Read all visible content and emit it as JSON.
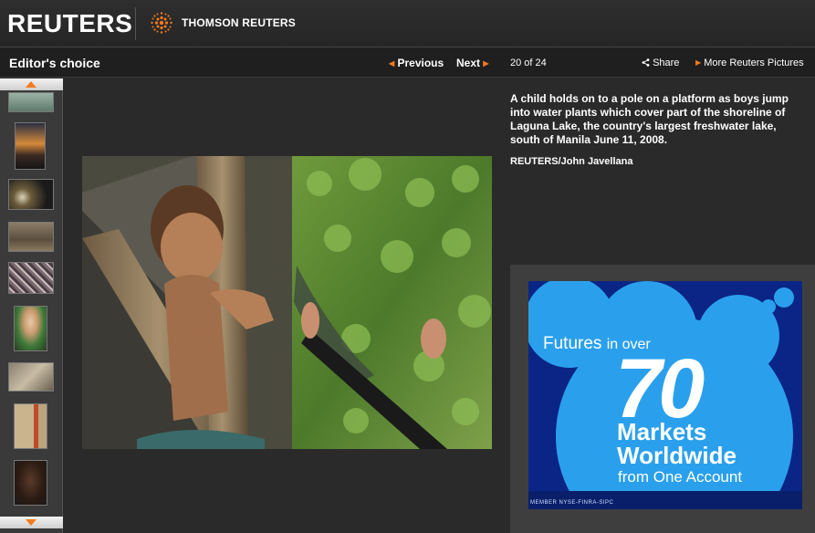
{
  "header": {
    "logo": "REUTERS",
    "partner": "THOMSON REUTERS"
  },
  "toolbar": {
    "section_title": "Editor's choice",
    "previous": "Previous",
    "next": "Next",
    "counter": "20 of 24",
    "share": "Share",
    "more": "More Reuters Pictures"
  },
  "caption": {
    "text": "A child holds on to a pole on a platform as boys jump into water plants which cover part of the shoreline of Laguna Lake, the country's largest freshwater lake, south of Manila June 11, 2008.",
    "credit": "REUTERS/John Javellana"
  },
  "ad": {
    "line1_a": "Futures",
    "line1_b": "in over",
    "big": "70",
    "line2": "Markets",
    "line3": "Worldwide",
    "line4": "from One Account",
    "member": "MEMBER NYSE-FINRA-SIPC"
  },
  "icons": {
    "prev": "triangle-left",
    "next": "triangle-right",
    "share": "share-icon",
    "more": "triangle-right"
  },
  "colors": {
    "accent": "#f47b20",
    "background": "#2a2a2a",
    "ad_blue": "#2a9de8"
  }
}
